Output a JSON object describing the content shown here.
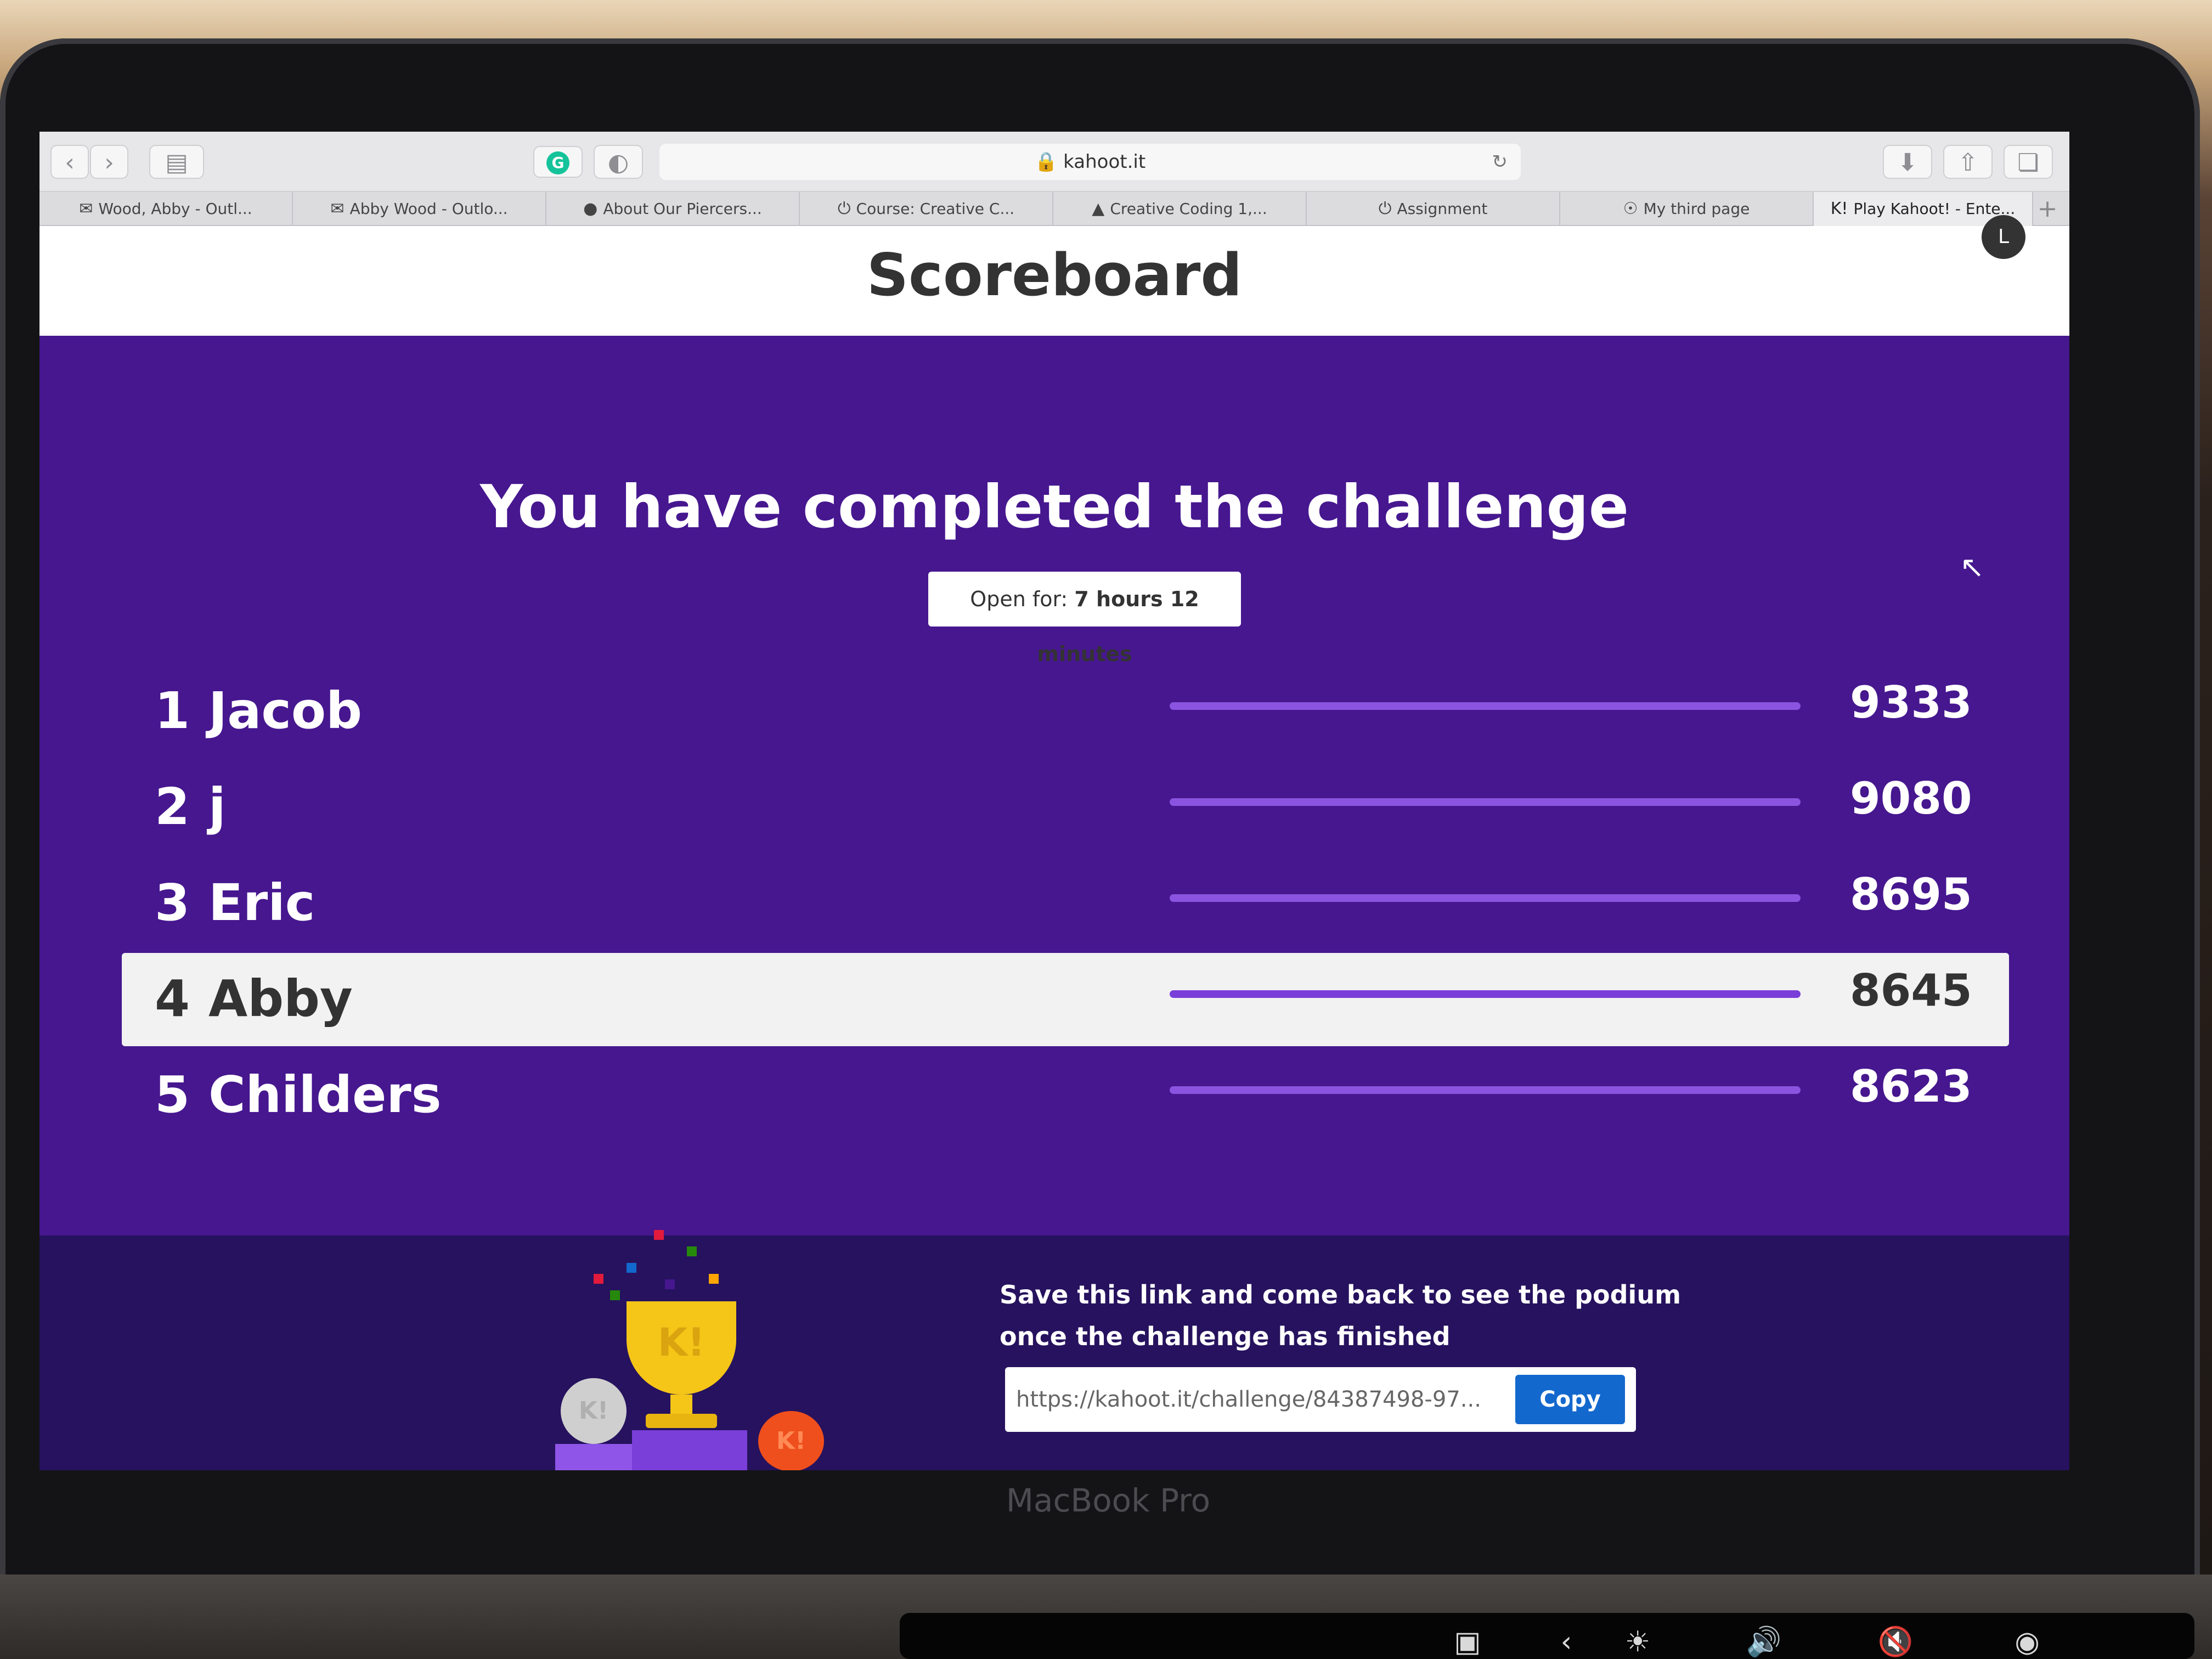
{
  "browser": {
    "url": "kahoot.it",
    "tabs": [
      {
        "label": "Wood, Abby - Outl...",
        "icon": "outlook-icon"
      },
      {
        "label": "Abby Wood - Outlo...",
        "icon": "outlook-icon"
      },
      {
        "label": "About Our Piercers...",
        "icon": "site-icon"
      },
      {
        "label": "Course: Creative C...",
        "icon": "power-icon"
      },
      {
        "label": "Creative Coding 1,...",
        "icon": "drive-icon"
      },
      {
        "label": "Assignment",
        "icon": "power-icon"
      },
      {
        "label": "My third page",
        "icon": "compass-icon"
      },
      {
        "label": "Play Kahoot! - Ente...",
        "icon": "kahoot-icon"
      }
    ]
  },
  "page": {
    "title": "Scoreboard",
    "headline": "You have completed the challenge",
    "open_for_label": "Open for:",
    "open_for_value": "7 hours 12 minutes"
  },
  "scoreboard": [
    {
      "rank": "1",
      "name": "Jacob",
      "score": "9333",
      "highlight": false
    },
    {
      "rank": "2",
      "name": "j",
      "score": "9080",
      "highlight": false
    },
    {
      "rank": "3",
      "name": "Eric",
      "score": "8695",
      "highlight": false
    },
    {
      "rank": "4",
      "name": "Abby",
      "score": "8645",
      "highlight": true
    },
    {
      "rank": "5",
      "name": "Childers",
      "score": "8623",
      "highlight": false
    }
  ],
  "footer": {
    "save_line1": "Save this link and come back to see the podium",
    "save_line2": "once the challenge has finished",
    "link_value": "https://kahoot.it/challenge/84387498-97...",
    "copy_label": "Copy"
  },
  "device": {
    "label": "MacBook Pro"
  },
  "colors": {
    "kahoot_purple": "#46178f",
    "footer_purple": "#26125e",
    "copy_blue": "#1368ce",
    "bar_purple": "#8b54e0"
  }
}
